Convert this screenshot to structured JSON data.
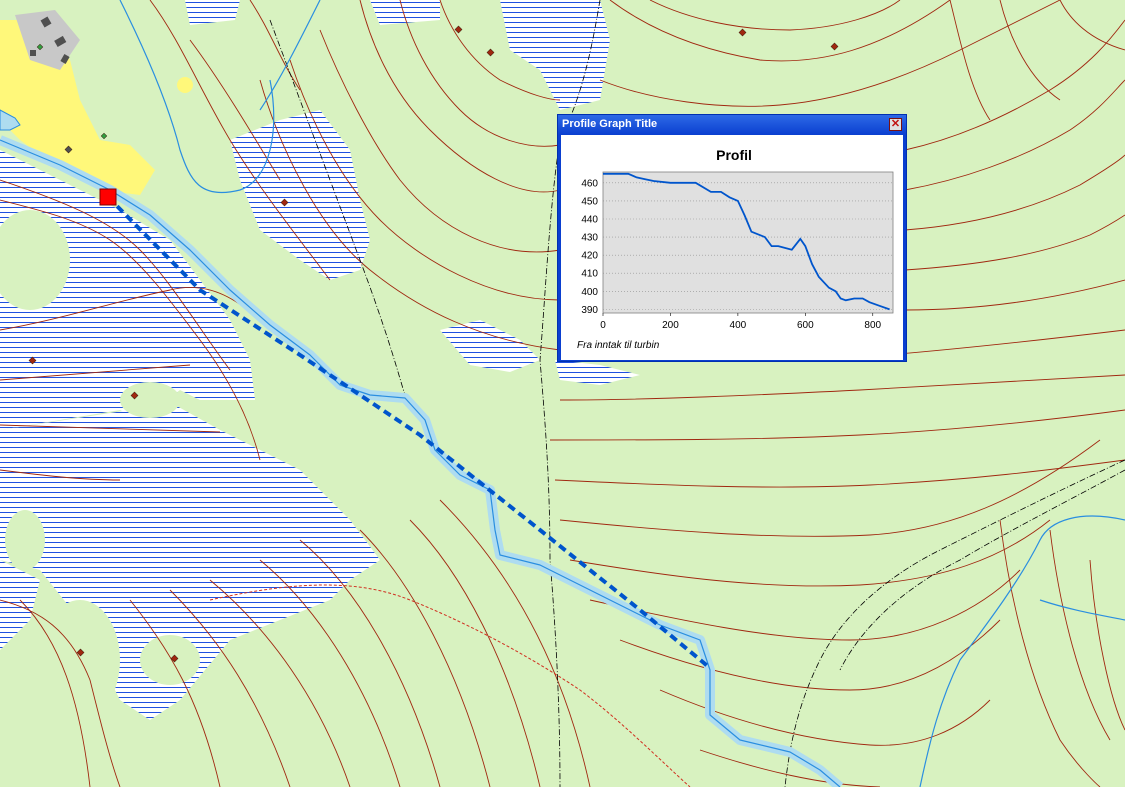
{
  "dialog": {
    "title": "Profile Graph Title",
    "close_glyph": "✕"
  },
  "chart_data": {
    "type": "line",
    "title": "Profil",
    "subtitle": "Fra inntak til turbin",
    "xlabel": "",
    "ylabel": "",
    "xlim": [
      0,
      860
    ],
    "ylim": [
      388,
      466
    ],
    "xticks": [
      0,
      200,
      400,
      600,
      800
    ],
    "yticks": [
      390,
      400,
      410,
      420,
      430,
      440,
      450,
      460
    ],
    "grid": true,
    "line_color": "#0055cc",
    "plot_background": "#e0e0e0",
    "series": [
      {
        "x": [
          0,
          75,
          100,
          125,
          150,
          200,
          250,
          275,
          320,
          350,
          375,
          400,
          420,
          440,
          480,
          500,
          520,
          560,
          585,
          600,
          620,
          640,
          670,
          690,
          705,
          720,
          745,
          770,
          790,
          820,
          850
        ],
        "y": [
          465,
          465,
          463,
          462,
          461,
          460,
          460,
          460,
          455,
          455,
          452,
          450,
          442,
          433,
          430,
          425,
          425,
          423,
          429,
          425,
          415,
          408,
          402,
          400,
          396,
          395,
          396,
          396,
          394,
          392,
          390
        ]
      }
    ]
  },
  "map": {
    "colors": {
      "vegetation": "#d8f2c0",
      "marsh_hatch": "#2050e0",
      "contour": "#a02810",
      "river": "#2a8ee0",
      "river_fill": "#aedcf0",
      "profile_line": "#0055cc",
      "intake_marker": "#ff0000",
      "farmland": "#fff87a"
    }
  }
}
